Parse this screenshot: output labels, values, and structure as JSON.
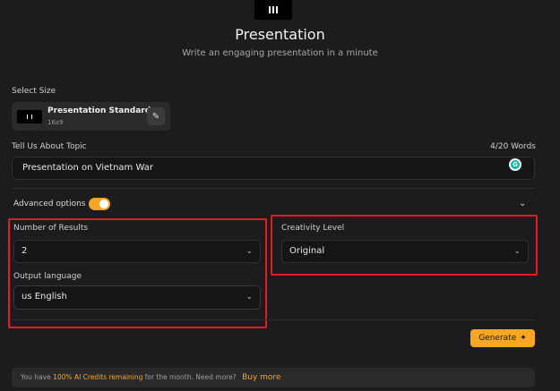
{
  "header": {
    "title": "Presentation",
    "subtitle": "Write an engaging presentation in a minute"
  },
  "size": {
    "label": "Select Size",
    "name": "Presentation Standard",
    "ratio": "16x9",
    "edit_icon": "pencil-icon"
  },
  "topic": {
    "label": "Tell Us About Topic",
    "word_count": "4/20 Words",
    "value": "Presentation on Vietnam War",
    "grammar_icon": "G"
  },
  "advanced": {
    "label": "Advanced options",
    "enabled": true,
    "expand_icon": "chevron-down-icon"
  },
  "results": {
    "label": "Number of Results",
    "value": "2"
  },
  "creativity": {
    "label": "Creativity Level",
    "value": "Original"
  },
  "language": {
    "label": "Output language",
    "value": "us English"
  },
  "generate": {
    "label": "Generate",
    "icon": "magic-wand-icon"
  },
  "footer": {
    "prefix": "You have ",
    "credits": "100% AI Credits remaining",
    "suffix": " for the month. Need more?",
    "buy_link": "Buy more"
  },
  "colors": {
    "accent": "#f5a623",
    "highlight": "#e31d1d",
    "background": "#1c1c1e"
  }
}
